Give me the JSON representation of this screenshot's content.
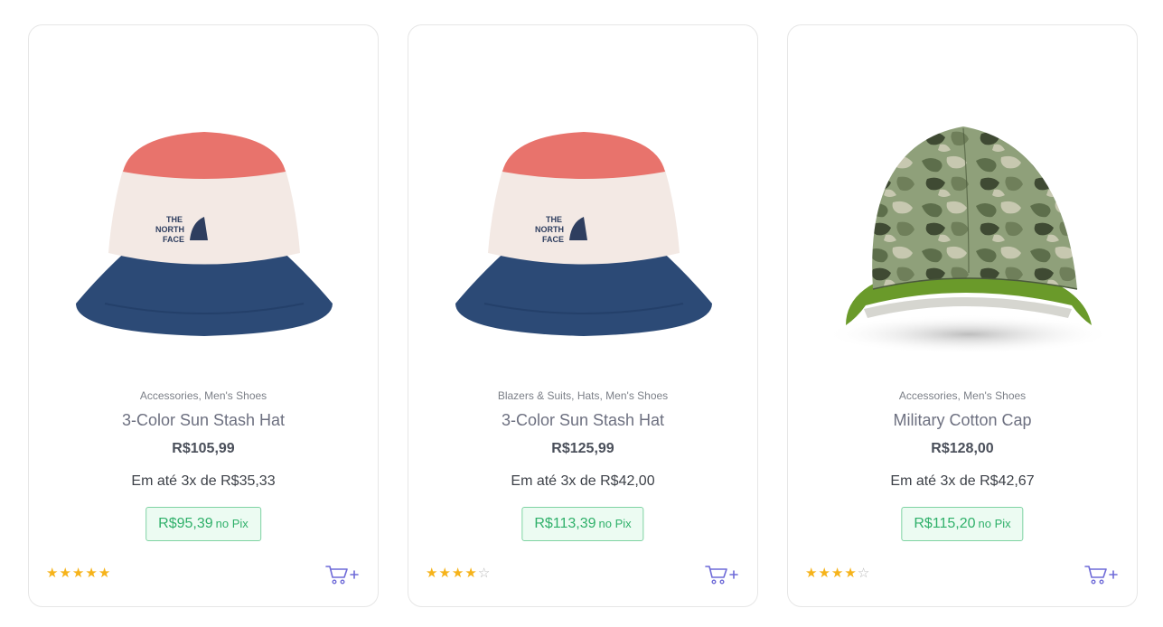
{
  "products": [
    {
      "image": "bucket-hat-image",
      "categories": "Accessories, Men's Shoes",
      "name": "3-Color Sun Stash Hat",
      "price": "R$105,99",
      "installments": "Em até 3x de R$35,33",
      "pix_price": "R$95,39",
      "pix_label": "no Pix",
      "rating": 5,
      "logo_text": [
        "THE",
        "NORTH",
        "FACE"
      ],
      "cart_icon": "cart-plus-icon"
    },
    {
      "image": "bucket-hat-image",
      "categories": "Blazers & Suits, Hats, Men's Shoes",
      "name": "3-Color Sun Stash Hat",
      "price": "R$125,99",
      "installments": "Em até 3x de R$42,00",
      "pix_price": "R$113,39",
      "pix_label": "no Pix",
      "rating": 4,
      "logo_text": [
        "THE",
        "NORTH",
        "FACE"
      ],
      "cart_icon": "cart-plus-icon"
    },
    {
      "image": "camo-cap-image",
      "categories": "Accessories, Men's Shoes",
      "name": "Military Cotton Cap",
      "price": "R$128,00",
      "installments": "Em até 3x de R$42,67",
      "pix_price": "R$115,20",
      "pix_label": "no Pix",
      "rating": 4,
      "cart_icon": "cart-plus-icon"
    }
  ],
  "colors": {
    "star": "#f6b31a",
    "star_empty": "#b8b8b8",
    "cart": "#6f6bd8",
    "pix_text": "#2fb06a",
    "pix_bg": "#ecfbf2",
    "pix_border": "#7fd3a3"
  }
}
